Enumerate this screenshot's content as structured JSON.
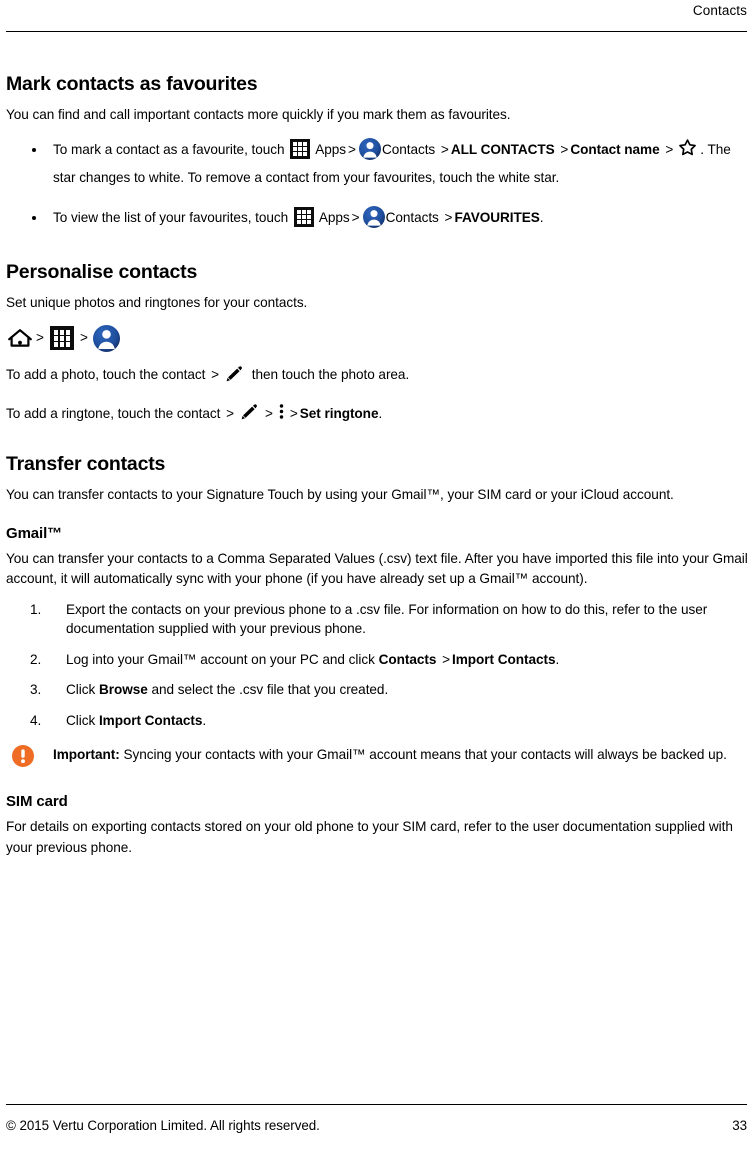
{
  "header": {
    "running_head": "Contacts"
  },
  "sections": {
    "favourites": {
      "title": "Mark contacts as favourites",
      "intro": "You can find and call important contacts more quickly if you mark them as favourites.",
      "bullets": {
        "one": {
          "part1": "To mark a contact as a favourite, touch",
          "apps_label": "Apps",
          "sep": ">",
          "contacts_label": "Contacts",
          "all_contacts": "ALL CONTACTS",
          "contact_name": "Contact name",
          "part2": ". The star changes to white. To remove a contact from your favourites, touch the white star."
        },
        "two": {
          "part1": "To view the list of your favourites, touch",
          "apps_label": "Apps",
          "sep": ">",
          "contacts_label": "Contacts",
          "favourites": "FAVOURITES",
          "period": "."
        }
      }
    },
    "personalise": {
      "title": "Personalise contacts",
      "intro": "Set unique photos and ringtones for your contacts.",
      "path_sep": ">",
      "photo_line": {
        "part1": "To add a photo, touch the contact",
        "sep": ">",
        "part2": "then touch the photo area."
      },
      "ringtone_line": {
        "part1": "To add a ringtone, touch the contact",
        "sep1": ">",
        "sep2": ">",
        "set_ringtone": "Set ringtone",
        "period": "."
      }
    },
    "transfer": {
      "title": "Transfer contacts",
      "intro": "You can transfer contacts to your Signature Touch by using your Gmail™, your SIM card or your iCloud account.",
      "gmail": {
        "title": "Gmail™",
        "intro": "You can transfer your contacts to a Comma Separated Values (.csv) text file. After you have imported this file into your Gmail account, it will automatically sync with your phone (if you have already set up a Gmail™ account).",
        "steps": [
          {
            "number": "1.",
            "text": "Export the contacts on your previous phone to a .csv file. For information on how to do this, refer to the user documentation supplied with your previous phone."
          },
          {
            "number": "2.",
            "pre": "Log into your Gmail™ account on your PC and click",
            "bold1": "Contacts",
            "sep": ">",
            "bold2": "Import Contacts",
            "post": "."
          },
          {
            "number": "3.",
            "pre": "Click",
            "bold1": "Browse",
            "post": "and select the .csv file that you created."
          },
          {
            "number": "4.",
            "pre": "Click",
            "bold1": "Import Contacts",
            "post": "."
          }
        ],
        "important": {
          "label": "Important:",
          "text": "Syncing your contacts with your Gmail™ account means that your contacts will always be backed up."
        }
      },
      "sim": {
        "title": "SIM card",
        "text": "For details on exporting contacts stored on your old phone to your SIM card, refer to the user documentation supplied with your previous phone."
      }
    }
  },
  "footer": {
    "copyright": "© 2015 Vertu Corporation Limited. All rights reserved.",
    "page_number": "33"
  },
  "colors": {
    "contacts_icon_blue": "#1f4f9e",
    "contacts_icon_blue_dark": "#14306b",
    "apps_icon_black": "#0d0d0d",
    "important_orange": "#ee6c24",
    "text_black": "#000000"
  }
}
